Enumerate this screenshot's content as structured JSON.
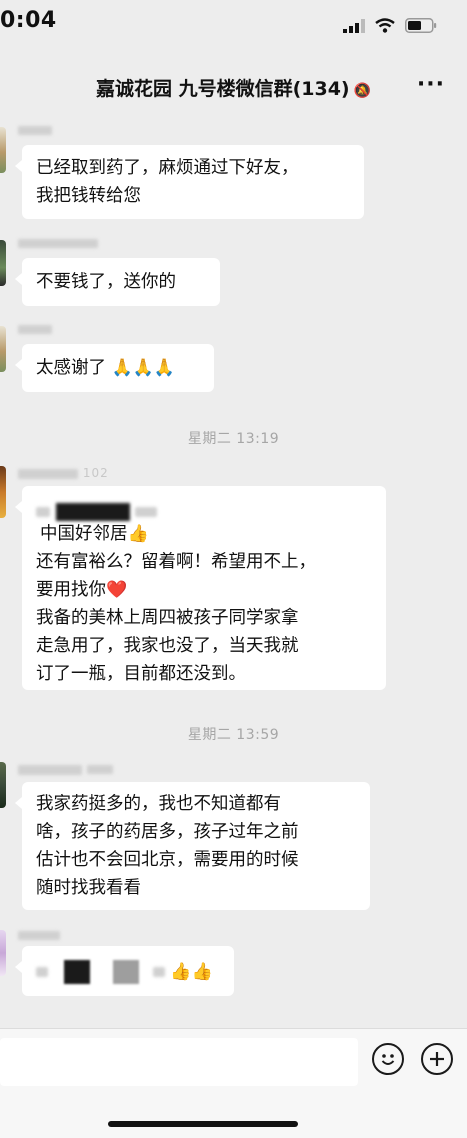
{
  "statusbar": {
    "time": "0:04"
  },
  "header": {
    "title": "嘉诚花园 九号楼微信群(134)"
  },
  "messages": [
    {
      "lines": [
        "已经取到药了，麻烦通过下好友，",
        "我把钱转给您"
      ]
    },
    {
      "lines": [
        "不要钱了，送你的"
      ]
    },
    {
      "text": "太感谢了",
      "emoji": "🙏🙏🙏"
    },
    {
      "timestamp": "星期二 13:19"
    },
    {
      "sender_partial": "102",
      "line0": "中国好邻居",
      "line0_emoji": "👍",
      "lines": [
        "还有富裕么？留着啊！希望用不上，",
        "要用找你",
        "我备的美林上周四被孩子同学家拿",
        "走急用了，我家也没了，当天我就",
        "订了一瓶，目前都还没到。"
      ],
      "heart": "❤️"
    },
    {
      "timestamp": "星期二 13:59"
    },
    {
      "lines": [
        "我家药挺多的，我也不知道都有",
        "啥，孩子的药居多，孩子过年之前",
        "估计也不会回北京，需要用的时候",
        "随时找我看看"
      ]
    },
    {
      "emoji": "👍👍"
    }
  ],
  "icons": [
    "signal-icon",
    "wifi-icon",
    "battery-icon",
    "mute-icon",
    "more-icon",
    "emoji-icon",
    "plus-icon"
  ]
}
